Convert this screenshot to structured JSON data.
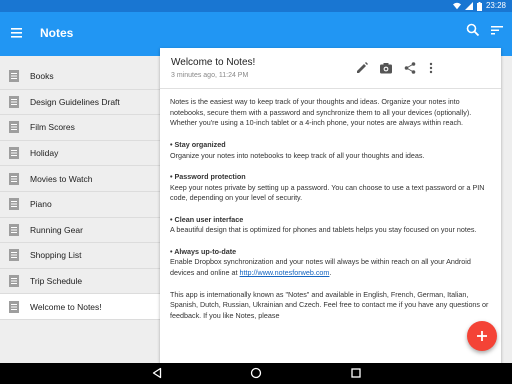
{
  "status": {
    "time": "23:28"
  },
  "appbar": {
    "title": "Notes"
  },
  "notes": [
    {
      "label": "Books",
      "selected": false
    },
    {
      "label": "Design Guidelines Draft",
      "selected": false
    },
    {
      "label": "Film Scores",
      "selected": false
    },
    {
      "label": "Holiday",
      "selected": false
    },
    {
      "label": "Movies to Watch",
      "selected": false
    },
    {
      "label": "Piano",
      "selected": false
    },
    {
      "label": "Running Gear",
      "selected": false
    },
    {
      "label": "Shopping List",
      "selected": false
    },
    {
      "label": "Trip Schedule",
      "selected": false
    },
    {
      "label": "Welcome to Notes!",
      "selected": true
    }
  ],
  "note": {
    "title": "Welcome to Notes!",
    "meta": "3 minutes ago, 11:24 PM",
    "intro": "Notes is the easiest way to keep track of your thoughts and ideas. Organize your notes into notebooks, secure them with a password and synchronize them to all your devices (optionally). Whether you're using a 10-inch tablet or a 4-inch phone, your notes are always within reach.",
    "s1_title": "• Stay organized",
    "s1_body": "Organize your notes into notebooks to keep track of all your thoughts and ideas.",
    "s2_title": "• Password protection",
    "s2_body": "Keep your notes private by setting up a password. You can choose to use a text password or a PIN code, depending on your level of security.",
    "s3_title": "• Clean user interface",
    "s3_body": "A beautiful design that is optimized for phones and tablets helps you stay focused on your notes.",
    "s4_title": "• Always up-to-date",
    "s4_body": "Enable Dropbox synchronization and your notes will always be within reach on all your Android devices and online at ",
    "s4_link": "http://www.notesforweb.com",
    "s4_end": ".",
    "outro": "This app is internationally known as \"Notes\" and available in English, French, German, Italian, Spanish, Dutch, Russian, Ukrainian and Czech. Feel free to contact me if you have any questions or feedback. If you like Notes, please"
  },
  "icons": {
    "menu": "menu-icon",
    "search": "search-icon",
    "sort": "sort-icon",
    "edit": "edit-icon",
    "camera": "camera-icon",
    "share": "share-icon",
    "more": "more-vert-icon",
    "add": "add-icon",
    "back": "back-icon",
    "home": "home-icon",
    "recents": "recents-icon"
  },
  "colors": {
    "primary": "#2196f3",
    "status": "#1976d2",
    "accent": "#f44336"
  }
}
